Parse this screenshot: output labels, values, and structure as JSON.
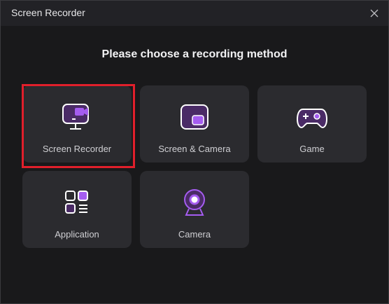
{
  "window": {
    "title": "Screen Recorder"
  },
  "heading": "Please choose a recording method",
  "options": [
    {
      "label": "Screen Recorder",
      "icon": "monitor-camera-icon",
      "selected": true
    },
    {
      "label": "Screen & Camera",
      "icon": "screen-camera-icon",
      "selected": false
    },
    {
      "label": "Game",
      "icon": "gamepad-icon",
      "selected": false
    },
    {
      "label": "Application",
      "icon": "app-grid-icon",
      "selected": false
    },
    {
      "label": "Camera",
      "icon": "webcam-icon",
      "selected": false
    }
  ],
  "colors": {
    "accent": "#9b59e6",
    "highlight": "#e01f2b",
    "card": "#2b2b2f",
    "background": "#19191b"
  }
}
